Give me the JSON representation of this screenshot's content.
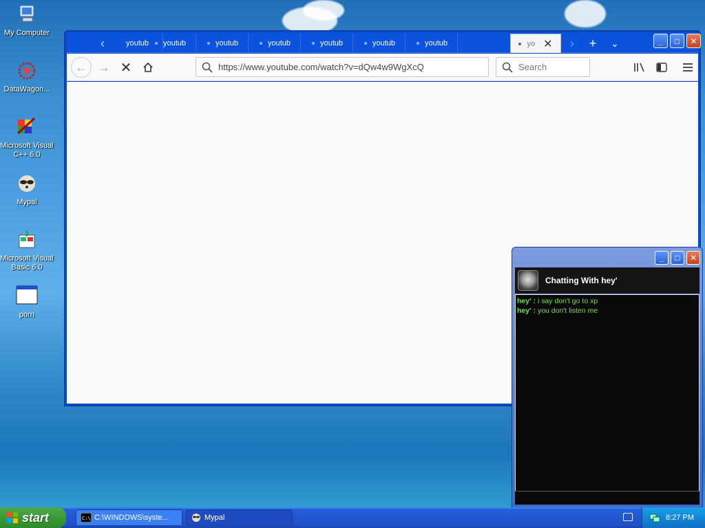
{
  "desktop": {
    "icons": [
      {
        "label": "My Computer",
        "icon": "my-computer-icon"
      },
      {
        "label": "DataWagon...",
        "icon": "datawagon-icon"
      },
      {
        "label": "Microsoft Visual C++ 6.0",
        "icon": "visual-cpp-icon"
      },
      {
        "label": "Mypal",
        "icon": "mypal-icon"
      },
      {
        "label": "Microsoft Visual Basic 6.0",
        "icon": "visual-basic-icon"
      },
      {
        "label": "porn",
        "icon": "application-icon"
      }
    ]
  },
  "browser": {
    "tabs": [
      "youtub",
      "youtub",
      "youtub",
      "youtub",
      "youtub",
      "youtub",
      "youtub",
      "yo"
    ],
    "active_tab_index": 7,
    "url": "https://www.youtube.com/watch?v=dQw4w9WgXcQ",
    "search_placeholder": "Search"
  },
  "chat": {
    "title": "Chatting With hey'",
    "messages": [
      {
        "sender": "hey' :",
        "text": "i say don't go to xp"
      },
      {
        "sender": "hey' :",
        "text": "you don't listen me"
      }
    ]
  },
  "taskbar": {
    "start_label": "start",
    "tasks": [
      {
        "label": "C:\\WINDOWS\\syste...",
        "icon": "cmd-icon"
      },
      {
        "label": "Mypal",
        "icon": "mypal-icon"
      }
    ],
    "clock": "8:27 PM"
  },
  "colors": {
    "xp_blue": "#0a49c2",
    "start_green": "#3a9b35",
    "chat_text": "#6ee33a"
  }
}
